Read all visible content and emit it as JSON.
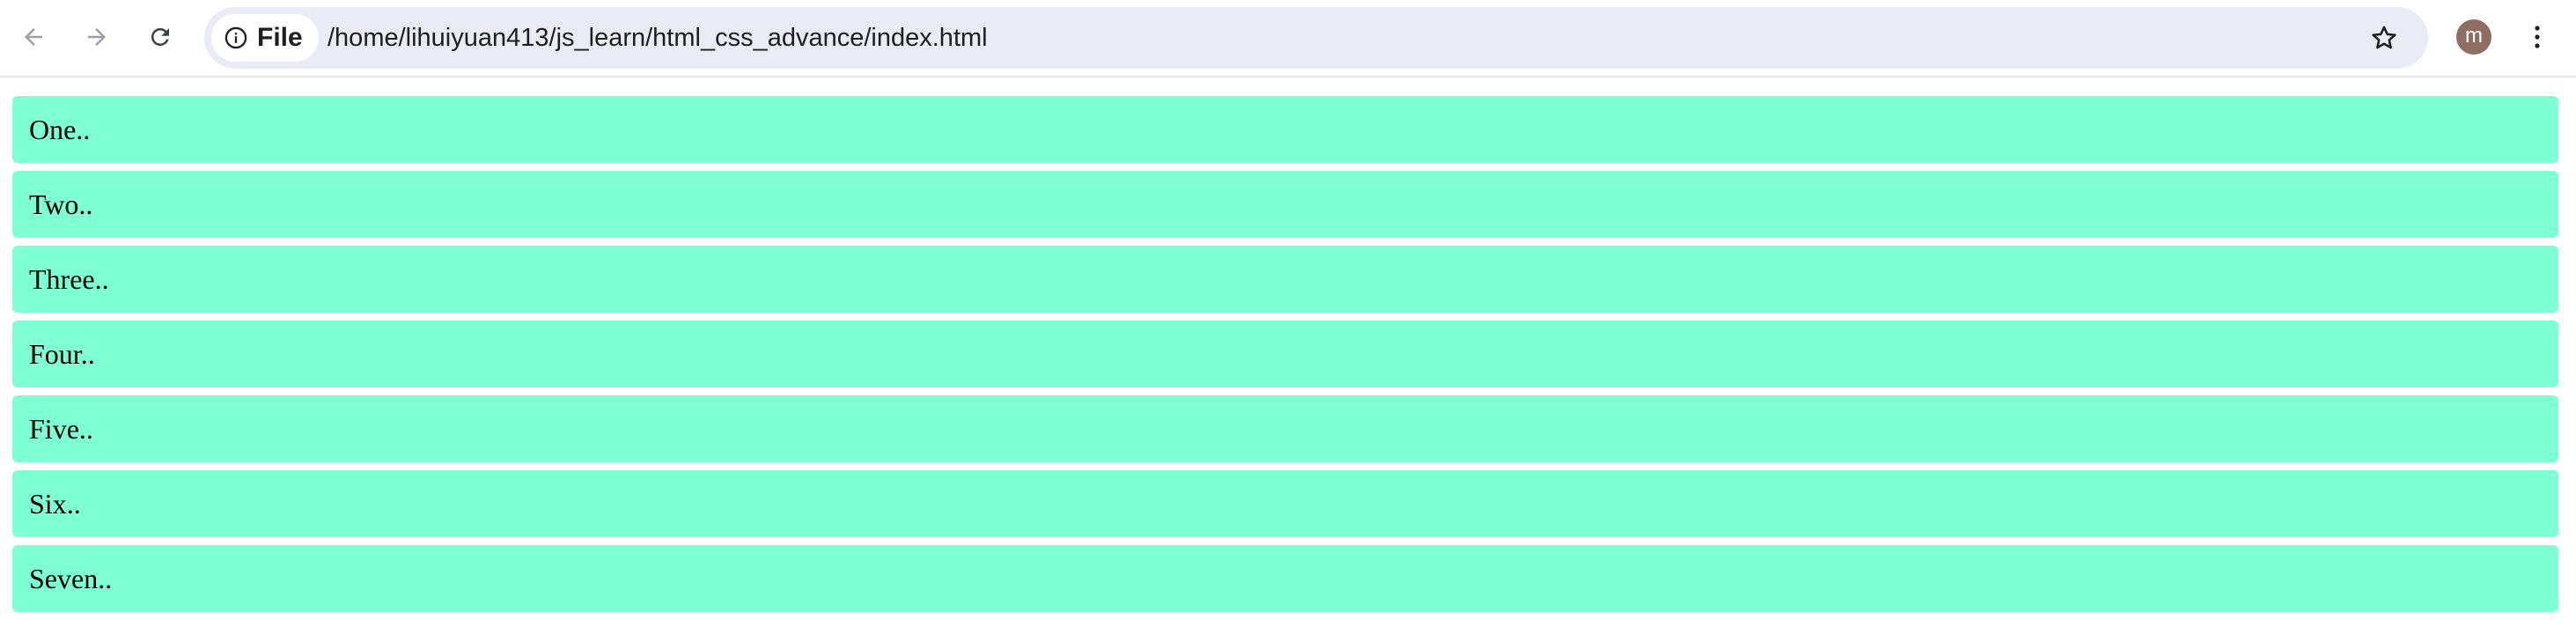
{
  "browser": {
    "site_chip_label": "File",
    "url": "/home/lihuiyuan413/js_learn/html_css_advance/index.html",
    "profile_initial": "m",
    "icons": {
      "back": "arrow-left-icon",
      "forward": "arrow-right-icon",
      "reload": "reload-icon",
      "site_info": "info-circle-icon",
      "bookmark": "star-icon",
      "menu": "vertical-dots-icon"
    }
  },
  "page": {
    "items": [
      {
        "label": "One.."
      },
      {
        "label": "Two.."
      },
      {
        "label": "Three.."
      },
      {
        "label": "Four.."
      },
      {
        "label": "Five.."
      },
      {
        "label": "Six.."
      },
      {
        "label": "Seven.."
      }
    ],
    "item_color": "#7fffd4"
  }
}
